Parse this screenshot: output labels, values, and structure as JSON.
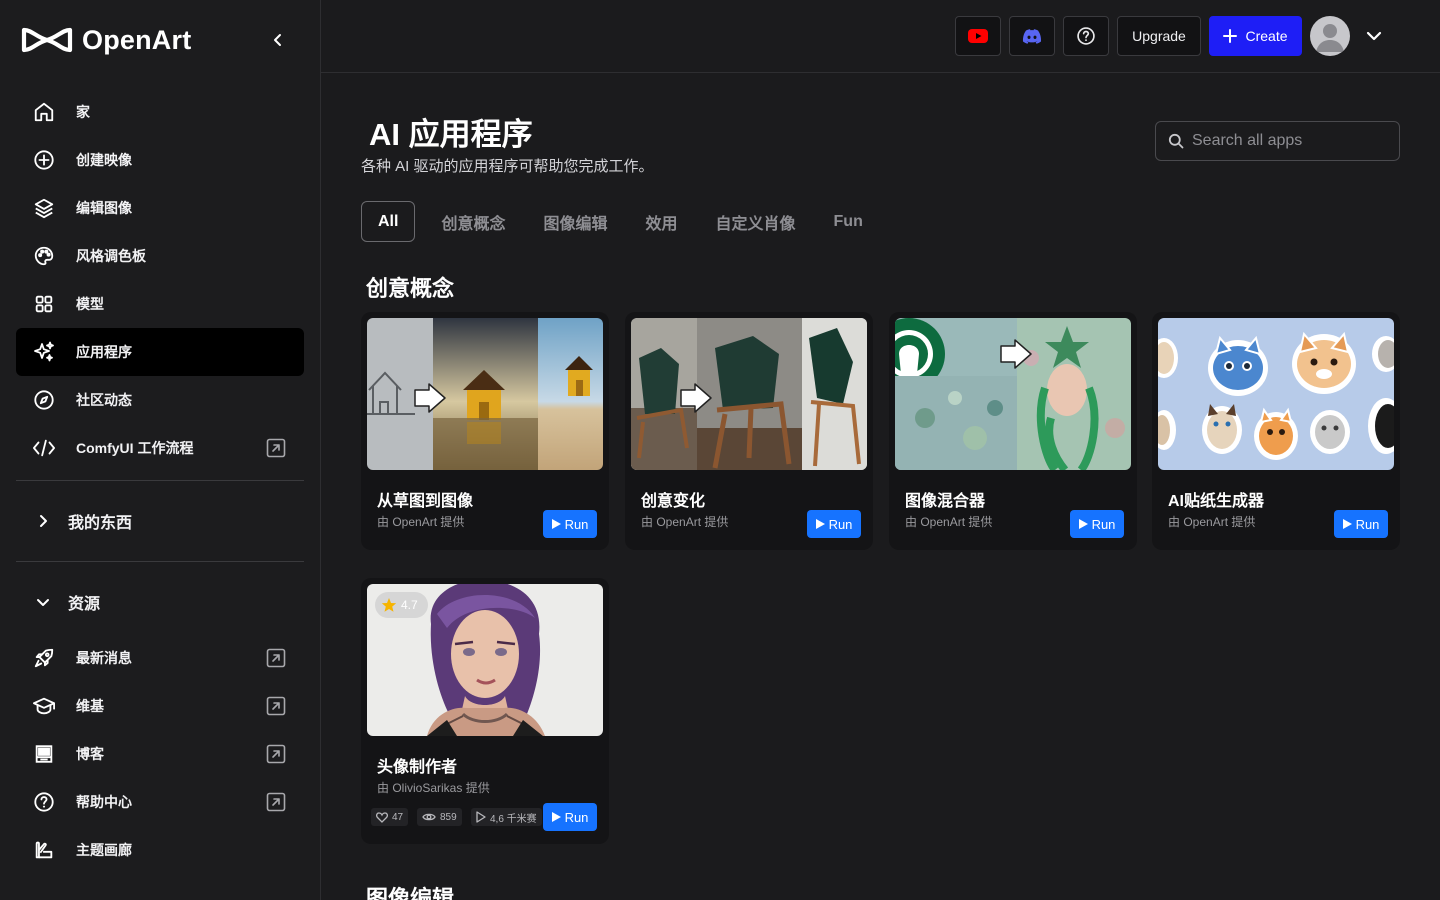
{
  "brand": {
    "name": "OpenArt"
  },
  "sidebar": {
    "items": [
      {
        "label": "家",
        "icon": "home-icon"
      },
      {
        "label": "创建映像",
        "icon": "plus-circle-icon"
      },
      {
        "label": "编辑图像",
        "icon": "layers-icon"
      },
      {
        "label": "风格调色板",
        "icon": "palette-icon"
      },
      {
        "label": "模型",
        "icon": "grid-icon"
      },
      {
        "label": "应用程序",
        "icon": "sparkles-icon",
        "active": true
      },
      {
        "label": "社区动态",
        "icon": "compass-icon"
      },
      {
        "label": "ComfyUI 工作流程",
        "icon": "code-icon",
        "external": true
      }
    ],
    "my_stuff": "我的东西",
    "resources": "资源",
    "resource_items": [
      {
        "label": "最新消息",
        "icon": "rocket-icon"
      },
      {
        "label": "维基",
        "icon": "graduation-cap-icon"
      },
      {
        "label": "博客",
        "icon": "blog-icon"
      },
      {
        "label": "帮助中心",
        "icon": "help-circle-icon"
      },
      {
        "label": "主题画廊",
        "icon": "gallery-icon"
      }
    ]
  },
  "topbar": {
    "upgrade_label": "Upgrade",
    "create_label": "Create",
    "colors": {
      "youtube": "#ff0000",
      "discord": "#5865f2",
      "create": "#1e1ef6"
    }
  },
  "page": {
    "title": "AI 应用程序",
    "subtitle": "各种 AI 驱动的应用程序可帮助您完成工作。",
    "search_placeholder": "Search all apps",
    "tabs": [
      "All",
      "创意概念",
      "图像编辑",
      "效用",
      "自定义肖像",
      "Fun"
    ]
  },
  "sections": [
    {
      "title": "创意概念",
      "cards": [
        {
          "title": "从草图到图像",
          "by": "由 OpenArt 提供",
          "run": "Run"
        },
        {
          "title": "创意变化",
          "by": "由 OpenArt 提供",
          "run": "Run"
        },
        {
          "title": "图像混合器",
          "by": "由 OpenArt 提供",
          "run": "Run"
        },
        {
          "title": "AI贴纸生成器",
          "by": "由 OpenArt 提供",
          "run": "Run"
        },
        {
          "title": "头像制作者",
          "by": "由 OlivioSarikas 提供",
          "run": "Run",
          "rating": "4.7",
          "likes": "47",
          "views": "859",
          "runs": "4,6 千米赛"
        }
      ]
    },
    {
      "title": "图像编辑"
    }
  ]
}
